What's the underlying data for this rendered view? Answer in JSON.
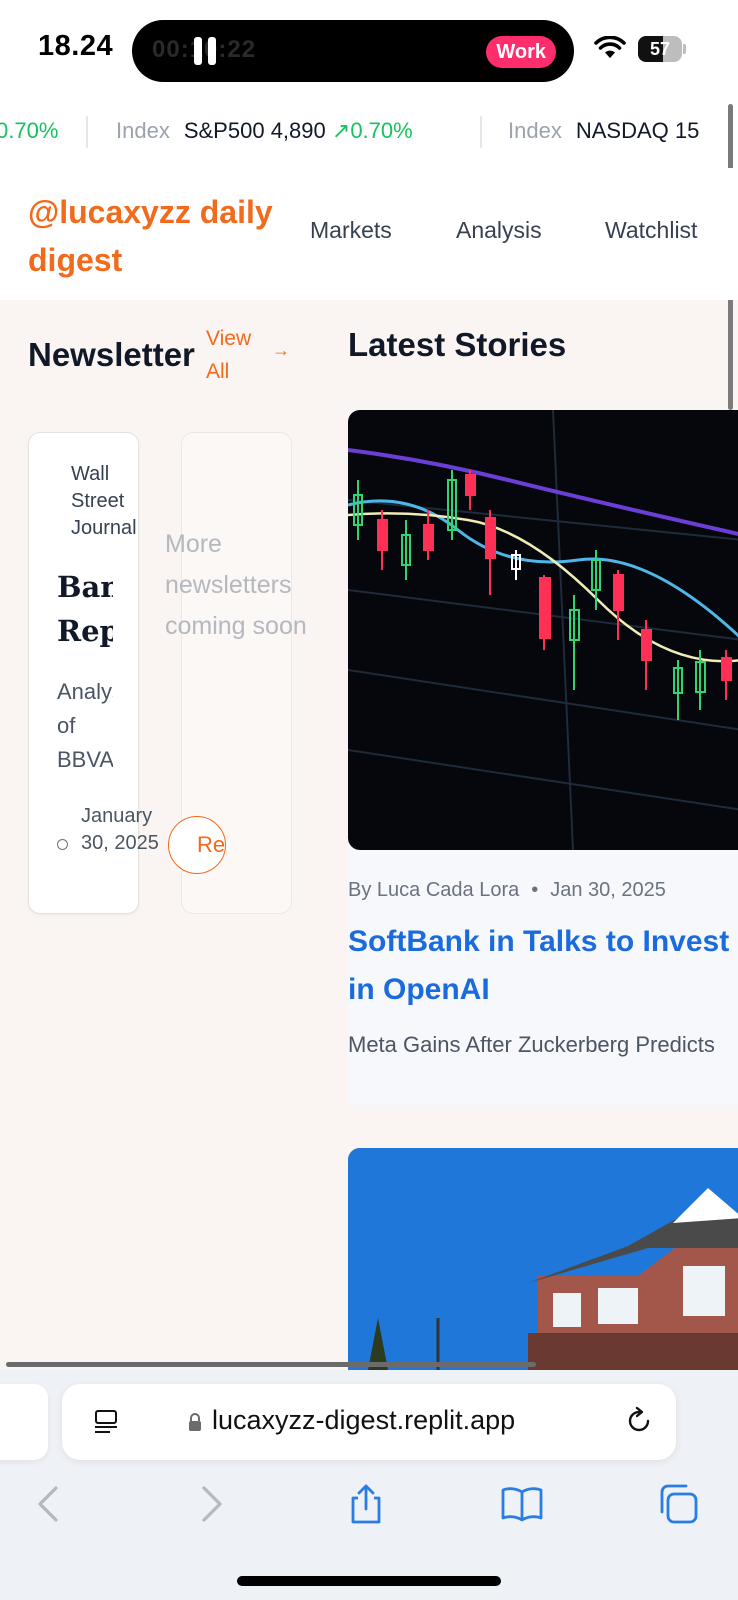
{
  "status_bar": {
    "time": "18.24",
    "island_timer": "00:10:22",
    "island_badge": "Work",
    "battery": "57",
    "battery_level": 0.57
  },
  "ticker": {
    "items": [
      {
        "prefix": "",
        "name": "",
        "value": "",
        "change": "0.70%"
      },
      {
        "prefix": "Index",
        "name": "S&P500",
        "value": "4,890",
        "change": "0.70%"
      },
      {
        "prefix": "Index",
        "name": "NASDAQ",
        "value": "15",
        "change": ""
      }
    ]
  },
  "header": {
    "brand": "@lucaxyzz daily digest",
    "nav": [
      "Markets",
      "Analysis",
      "Watchlist"
    ]
  },
  "newsletter": {
    "heading": "Newsletter",
    "view_all": "View All",
    "card": {
      "source": "Wall Street Journal",
      "title": "Banks Report",
      "description": "Analysis of BBVA",
      "date": "January 30, 2025"
    },
    "coming_soon": "More newsletters coming soon",
    "read_button": "Read"
  },
  "stories": {
    "heading": "Latest Stories",
    "items": [
      {
        "author": "By Luca Cada Lora",
        "date": "Jan 30, 2025",
        "title": "SoftBank in Talks to Invest in OpenAI",
        "excerpt": "Meta Gains After Zuckerberg Predicts"
      }
    ]
  },
  "browser": {
    "url": "lucaxyzz-digest.replit.app"
  },
  "colors": {
    "brand_orange": "#f26a1b",
    "link_blue": "#1a6bdc",
    "ticker_green": "#16c25f",
    "badge_pink": "#ff2d6b"
  }
}
